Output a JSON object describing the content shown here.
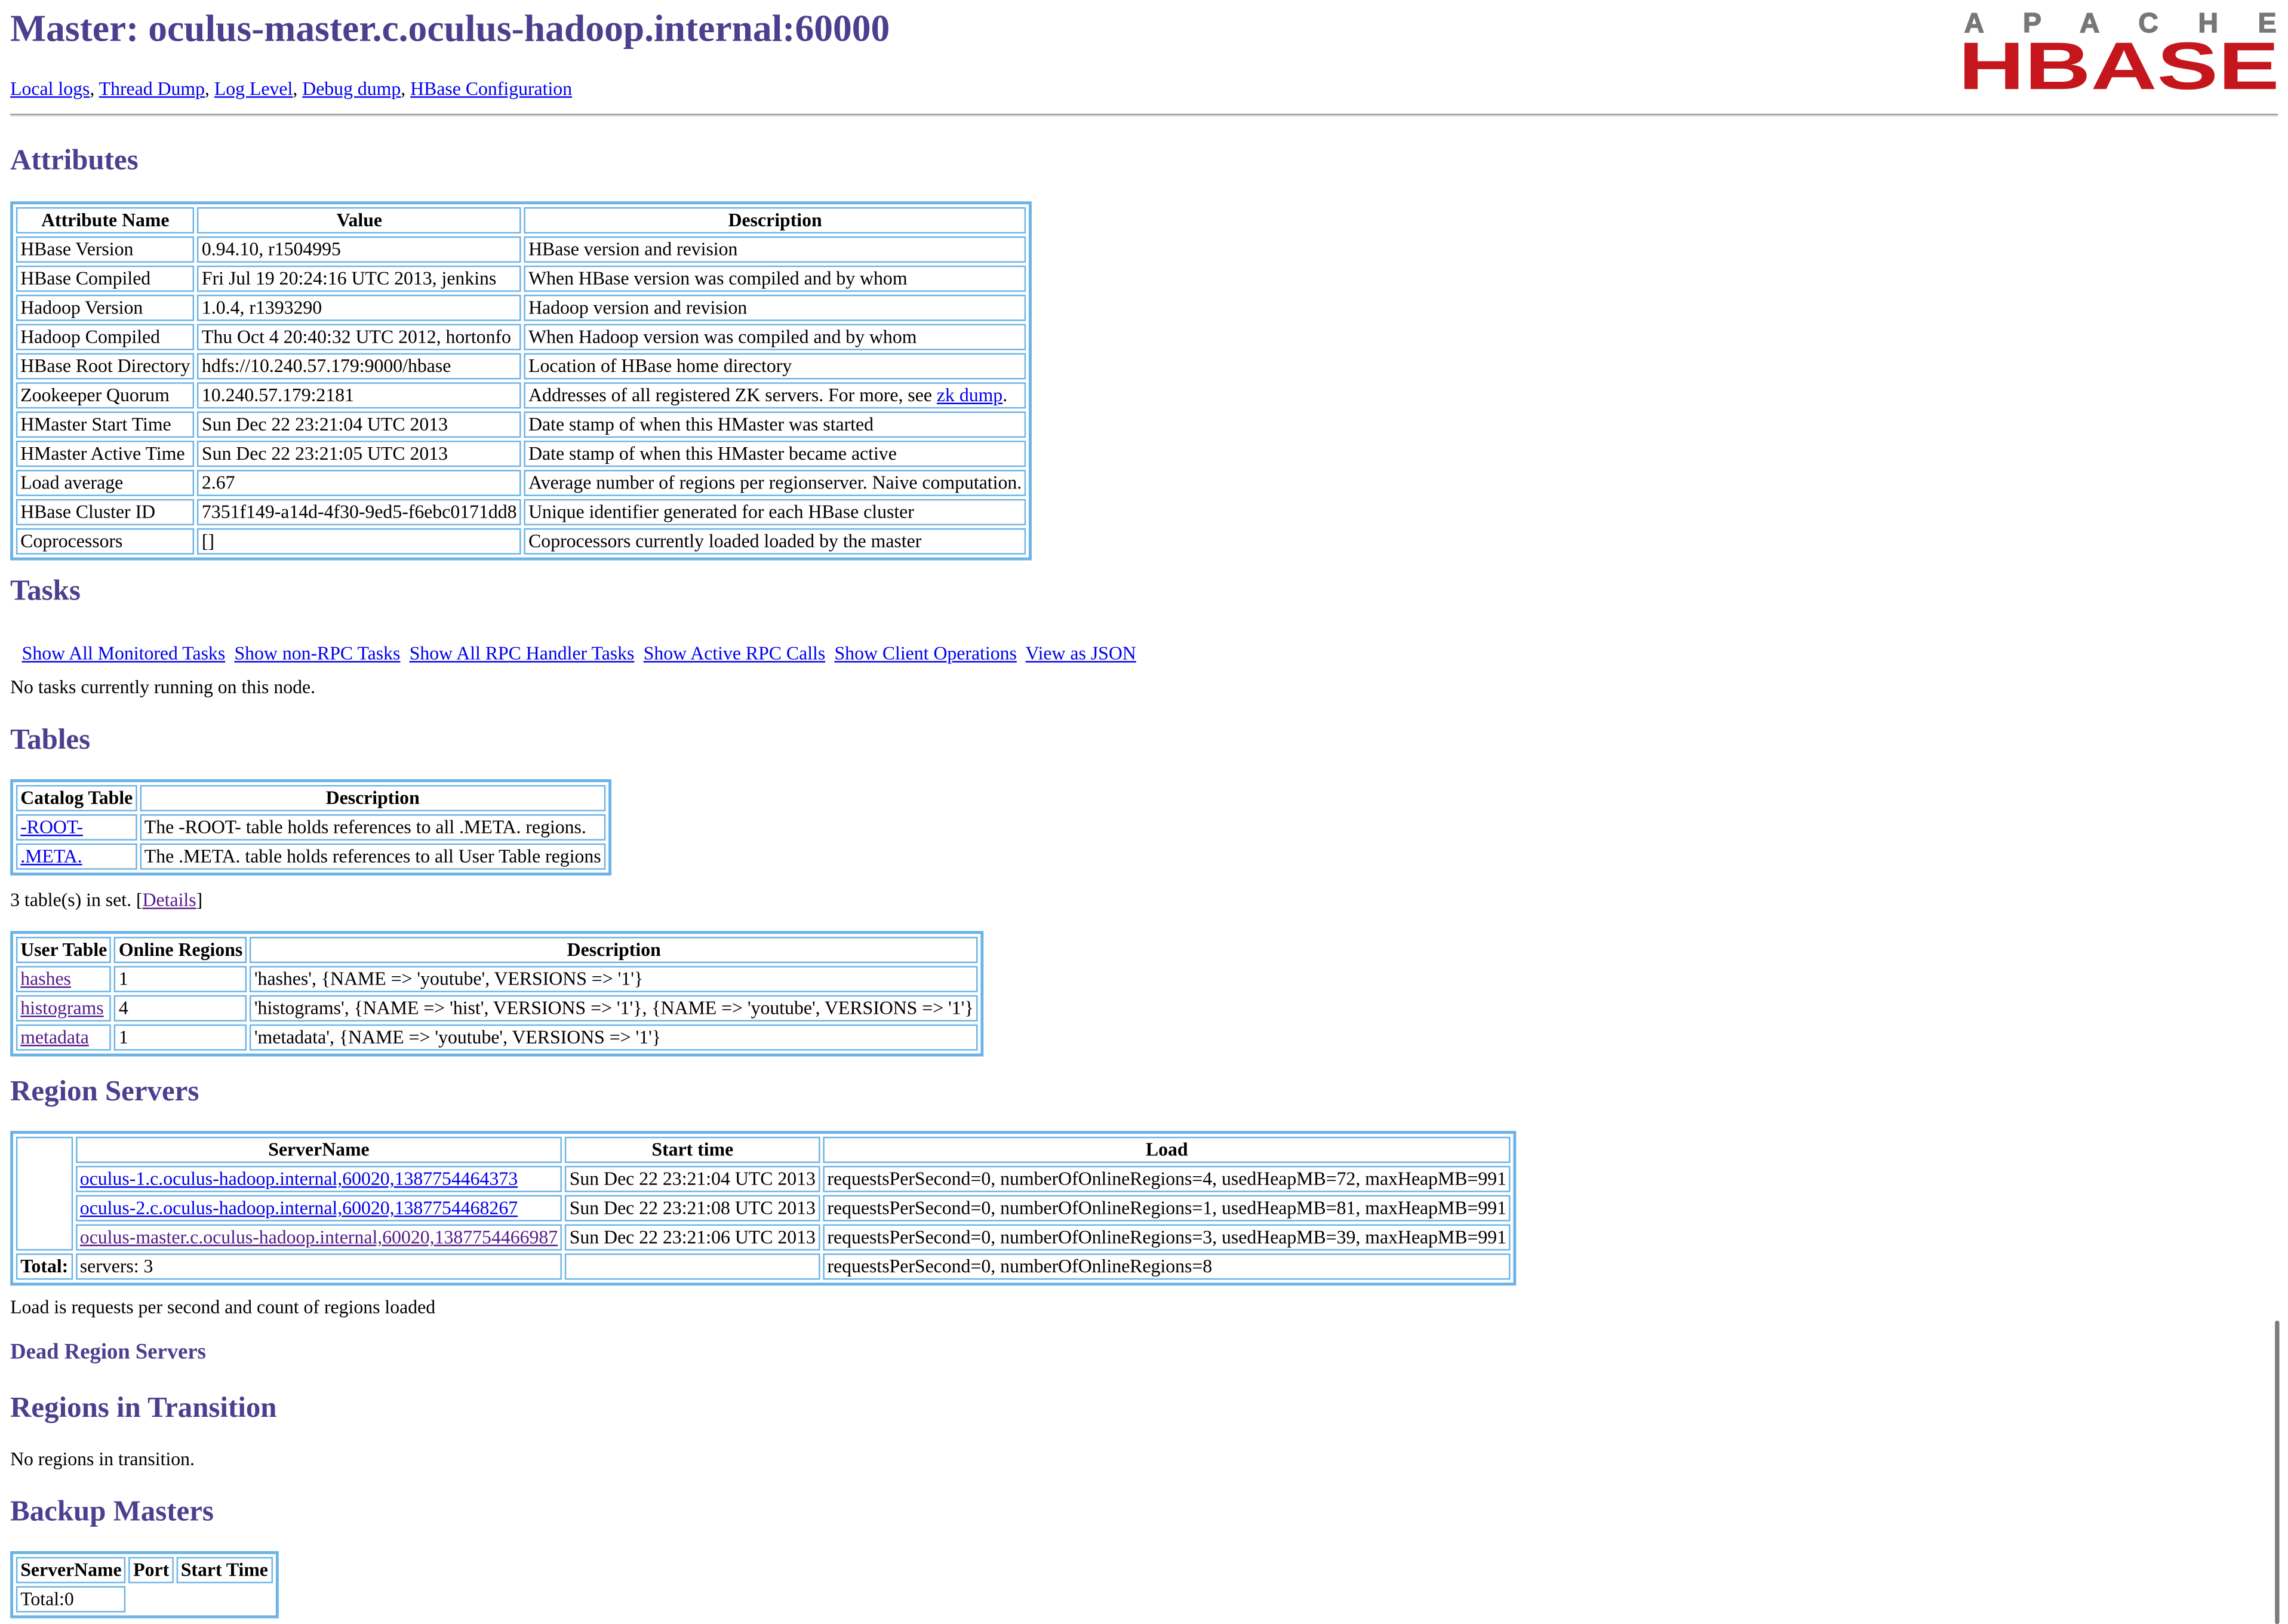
{
  "page_title": "Master: oculus-master.c.oculus-hadoop.internal:60000",
  "logo": {
    "top": "A P A C H E",
    "bottom": "HBASE"
  },
  "top_links": [
    "Local logs",
    "Thread Dump",
    "Log Level",
    "Debug dump",
    "HBase Configuration"
  ],
  "attributes": {
    "heading": "Attributes",
    "columns": [
      "Attribute Name",
      "Value",
      "Description"
    ],
    "rows": [
      [
        "HBase Version",
        "0.94.10, r1504995",
        "HBase version and revision"
      ],
      [
        "HBase Compiled",
        "Fri Jul 19 20:24:16 UTC 2013, jenkins",
        "When HBase version was compiled and by whom"
      ],
      [
        "Hadoop Version",
        "1.0.4, r1393290",
        "Hadoop version and revision"
      ],
      [
        "Hadoop Compiled",
        "Thu Oct 4 20:40:32 UTC 2012, hortonfo",
        "When Hadoop version was compiled and by whom"
      ],
      [
        "HBase Root Directory",
        "hdfs://10.240.57.179:9000/hbase",
        "Location of HBase home directory"
      ],
      [
        "Zookeeper Quorum",
        "10.240.57.179:2181",
        "Addresses of all registered ZK servers. For more, see "
      ],
      [
        "HMaster Start Time",
        "Sun Dec 22 23:21:04 UTC 2013",
        "Date stamp of when this HMaster was started"
      ],
      [
        "HMaster Active Time",
        "Sun Dec 22 23:21:05 UTC 2013",
        "Date stamp of when this HMaster became active"
      ],
      [
        "Load average",
        "2.67",
        "Average number of regions per regionserver. Naive computation."
      ],
      [
        "HBase Cluster ID",
        "7351f149-a14d-4f30-9ed5-f6ebc0171dd8",
        "Unique identifier generated for each HBase cluster"
      ],
      [
        "Coprocessors",
        "[]",
        "Coprocessors currently loaded loaded by the master"
      ]
    ],
    "zk_dump_link": "zk dump",
    "zk_dump_suffix": "."
  },
  "tasks": {
    "heading": "Tasks",
    "links": [
      "Show All Monitored Tasks",
      "Show non-RPC Tasks",
      "Show All RPC Handler Tasks",
      "Show Active RPC Calls",
      "Show Client Operations",
      "View as JSON"
    ],
    "status": "No tasks currently running on this node."
  },
  "tables": {
    "heading": "Tables",
    "catalog_columns": [
      "Catalog Table",
      "Description"
    ],
    "catalog_rows": [
      [
        "-ROOT-",
        "The -ROOT- table holds references to all .META. regions."
      ],
      [
        ".META.",
        "The .META. table holds references to all User Table regions"
      ]
    ],
    "count_text": "3 table(s) in set. [",
    "details_link": "Details",
    "count_suffix": "]",
    "user_columns": [
      "User Table",
      "Online Regions",
      "Description"
    ],
    "user_rows": [
      [
        "hashes",
        "1",
        "'hashes', {NAME => 'youtube', VERSIONS => '1'}"
      ],
      [
        "histograms",
        "4",
        "'histograms', {NAME => 'hist', VERSIONS => '1'}, {NAME => 'youtube', VERSIONS => '1'}"
      ],
      [
        "metadata",
        "1",
        "'metadata', {NAME => 'youtube', VERSIONS => '1'}"
      ]
    ]
  },
  "region_servers": {
    "heading": "Region Servers",
    "columns": [
      "ServerName",
      "Start time",
      "Load"
    ],
    "rows": [
      [
        "oculus-1.c.oculus-hadoop.internal,60020,1387754464373",
        "Sun Dec 22 23:21:04 UTC 2013",
        "requestsPerSecond=0, numberOfOnlineRegions=4, usedHeapMB=72, maxHeapMB=991"
      ],
      [
        "oculus-2.c.oculus-hadoop.internal,60020,1387754468267",
        "Sun Dec 22 23:21:08 UTC 2013",
        "requestsPerSecond=0, numberOfOnlineRegions=1, usedHeapMB=81, maxHeapMB=991"
      ],
      [
        "oculus-master.c.oculus-hadoop.internal,60020,1387754466987",
        "Sun Dec 22 23:21:06 UTC 2013",
        "requestsPerSecond=0, numberOfOnlineRegions=3, usedHeapMB=39, maxHeapMB=991"
      ]
    ],
    "total_label": "Total:",
    "total_servers": "servers: 3",
    "total_load": "requestsPerSecond=0, numberOfOnlineRegions=8",
    "note": "Load is requests per second and count of regions loaded"
  },
  "dead_region_servers": {
    "heading": "Dead Region Servers"
  },
  "regions_in_transition": {
    "heading": "Regions in Transition",
    "status": "No regions in transition."
  },
  "backup_masters": {
    "heading": "Backup Masters",
    "columns": [
      "ServerName",
      "Port",
      "Start Time"
    ],
    "total": "Total:0"
  },
  "colors": {
    "heading": "#4b3f8f",
    "link": "#0000ee",
    "visited_link": "#551a8b",
    "table_border": "#6cb3e6",
    "logo_red": "#c4161c",
    "logo_gray": "#777777"
  }
}
